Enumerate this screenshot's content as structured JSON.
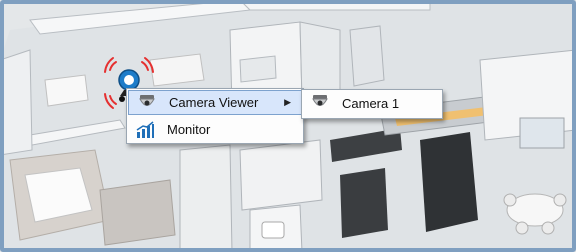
{
  "context_menu": {
    "items": [
      {
        "label": "Camera Viewer",
        "icon": "dome-camera-icon",
        "has_submenu": true,
        "highlighted": true
      },
      {
        "label": "Monitor",
        "icon": "bar-chart-icon",
        "has_submenu": false,
        "highlighted": false
      }
    ]
  },
  "submenu": {
    "items": [
      {
        "label": "Camera 1",
        "icon": "dome-camera-icon"
      }
    ]
  },
  "colors": {
    "highlight_bg": "#d8e6fb",
    "highlight_border": "#7da2ce",
    "frame_border": "#7f9fc0",
    "signal_red": "#e53030"
  }
}
